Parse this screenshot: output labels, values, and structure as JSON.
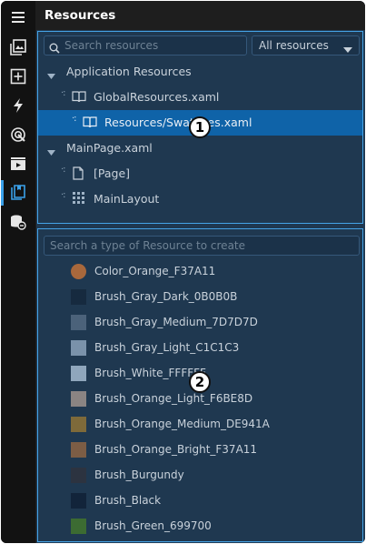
{
  "panel": {
    "title": "Resources"
  },
  "search": {
    "placeholder": "Search resources"
  },
  "filter": {
    "selected": "All resources"
  },
  "tree": {
    "app_resources": "Application Resources",
    "global_resources": "GlobalResources.xaml",
    "swatches": "Resources/Swatches.xaml",
    "main_page": "MainPage.xaml",
    "page": "[Page]",
    "main_layout": "MainLayout"
  },
  "create": {
    "placeholder": "Search a type of Resource to create"
  },
  "resources": [
    {
      "label": "Color_Orange_F37A11",
      "color": "#a8683c",
      "shape": "circle"
    },
    {
      "label": "Brush_Gray_Dark_0B0B0B",
      "color": "#162a3f",
      "shape": "square"
    },
    {
      "label": "Brush_Gray_Medium_7D7D7D",
      "color": "#4b627a",
      "shape": "square"
    },
    {
      "label": "Brush_Gray_Light_C1C1C3",
      "color": "#7a92aa",
      "shape": "square"
    },
    {
      "label": "Brush_White_FFFFFF",
      "color": "#8fa6bc",
      "shape": "square"
    },
    {
      "label": "Brush_Orange_Light_F6BE8D",
      "color": "#8a8483",
      "shape": "square"
    },
    {
      "label": "Brush_Orange_Medium_DE941A",
      "color": "#7e6a3a",
      "shape": "square"
    },
    {
      "label": "Brush_Orange_Bright_F37A11",
      "color": "#7c5d45",
      "shape": "square"
    },
    {
      "label": "Brush_Burgundy",
      "color": "#2c3340",
      "shape": "square"
    },
    {
      "label": "Brush_Black",
      "color": "#12243a",
      "shape": "square"
    },
    {
      "label": "Brush_Green_699700",
      "color": "#3c6b32",
      "shape": "square"
    }
  ],
  "callouts": {
    "one": "1",
    "two": "2"
  },
  "rail_icons": [
    "menu-icon",
    "gallery-icon",
    "add-box-icon",
    "lightning-icon",
    "target-icon",
    "media-icon",
    "resources-icon",
    "data-icon"
  ],
  "colors": {
    "accent": "#45a3e6",
    "selection": "#0f63a8",
    "panel": "#1f3850",
    "rail": "#121212"
  }
}
